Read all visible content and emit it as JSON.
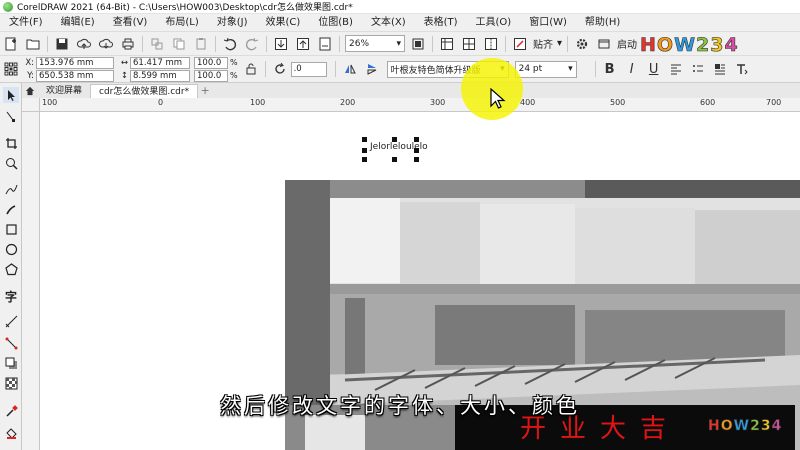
{
  "window": {
    "title": "CorelDRAW 2021 (64-Bit) - C:\\Users\\HOW003\\Desktop\\cdr怎么做效果图.cdr*"
  },
  "menu": [
    "文件(F)",
    "编辑(E)",
    "查看(V)",
    "布局(L)",
    "对象(J)",
    "效果(C)",
    "位图(B)",
    "文本(X)",
    "表格(T)",
    "工具(O)",
    "窗口(W)",
    "帮助(H)"
  ],
  "toolbar": {
    "zoom_value": "26%",
    "snap_label": "贴齐",
    "launch_label": "启动"
  },
  "properties": {
    "x": "153.976 mm",
    "y": "650.538 mm",
    "width": "61.417 mm",
    "height": "8.599 mm",
    "scale_x": "100.0",
    "scale_y": "100.0",
    "pct": "%",
    "rotation": ".0",
    "font_name": "叶根友特色简体升级版",
    "font_size": "24 pt",
    "style_buttons": [
      "B",
      "I",
      "U"
    ],
    "x_label": "X:",
    "y_label": "Y:"
  },
  "tabs": {
    "welcome": "欢迎屏幕",
    "document": "cdr怎么做效果图.cdr*"
  },
  "ruler_labels": [
    "100",
    "0",
    "100",
    "200",
    "300",
    "400",
    "500",
    "600",
    "700"
  ],
  "canvas": {
    "selected_text": "Jelorleloulelo",
    "shop_sign": "开业大吉"
  },
  "subtitle": "然后修改文字的字体、大小、颜色",
  "brand": {
    "text": "HOW234",
    "colors": [
      "#e8322a",
      "#f29a1b",
      "#2f9be0",
      "#8cc63f",
      "#f2c61b",
      "#d64fa0"
    ]
  }
}
